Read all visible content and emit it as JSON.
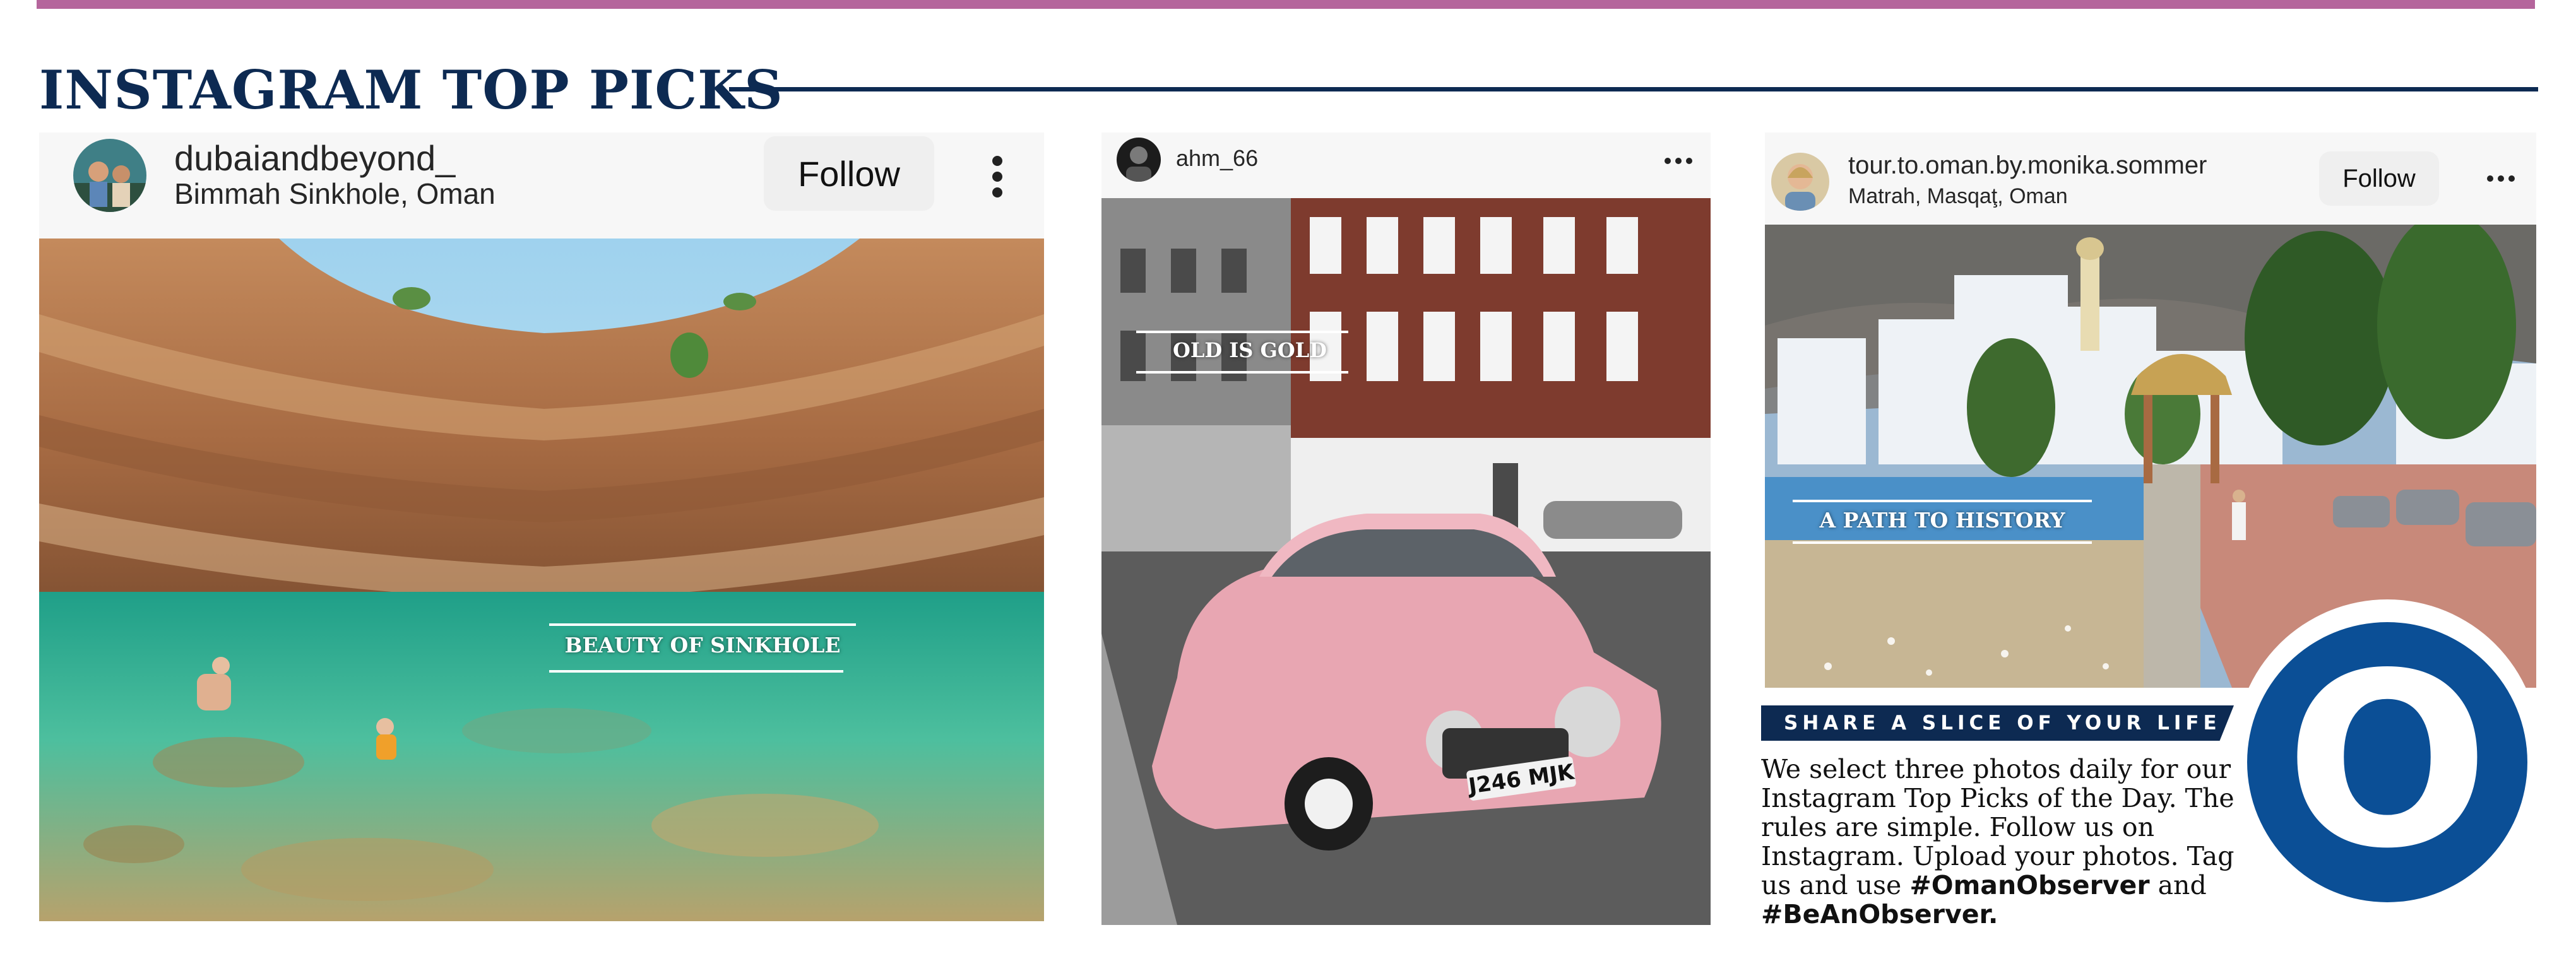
{
  "section": {
    "title": "INSTAGRAM TOP PICKS"
  },
  "posts": [
    {
      "username": "dubaiandbeyond_",
      "location": "Bimmah Sinkhole, Oman",
      "follow_label": "Follow",
      "caption": "BEAUTY OF SINKHOLE"
    },
    {
      "username": "ahm_66",
      "caption": "OLD IS GOLD",
      "plate": "J246 MJK"
    },
    {
      "username": "tour.to.oman.by.monika.sommer",
      "location": "Matrah, Masqaţ, Oman",
      "follow_label": "Follow",
      "caption": "A PATH TO HISTORY"
    }
  ],
  "promo": {
    "heading": "SHARE A SLICE OF YOUR LIFE",
    "body": "We select three photos daily for our Instagram Top Picks of the Day. The rules are simple. Follow us on Instagram. Upload your photos. Tag us and use",
    "hashtag_1": "#OmanObserver",
    "connector": "and",
    "hashtag_2": "#BeAnObserver."
  },
  "logo": {
    "letter": "O"
  },
  "colors": {
    "navy": "#0d2a52",
    "top_bar": "#b5659c",
    "logo_blue": "#0b4f96"
  },
  "icons": [
    "more-vertical-icon",
    "more-horizontal-icon"
  ]
}
